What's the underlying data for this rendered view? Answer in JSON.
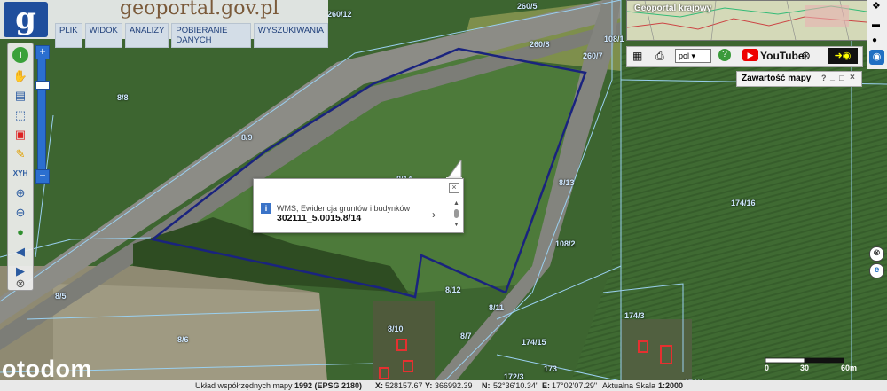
{
  "header": {
    "logo_glyph": "g",
    "site_name": "geoportal.gov.pl",
    "menu": [
      "PLIK",
      "WIDOK",
      "ANALIZY",
      "POBIERANIE DANYCH",
      "WYSZUKIWANIA"
    ]
  },
  "overview": {
    "title": "Geoportal krajowy"
  },
  "toolbar_right": {
    "language": "pol",
    "youtube_label": "YouTube"
  },
  "legend_panel": {
    "title": "Zawartość mapy",
    "buttons": [
      "?",
      "_",
      "□",
      "×"
    ]
  },
  "popup": {
    "source": "WMS, Ewidencja gruntów i budynków",
    "parcel_id": "302111_5.0015.8/14"
  },
  "parcels": [
    {
      "label": "260/12"
    },
    {
      "label": "260/5"
    },
    {
      "label": "260/8"
    },
    {
      "label": "260/7"
    },
    {
      "label": "108/1"
    },
    {
      "label": "8/8"
    },
    {
      "label": "8/9"
    },
    {
      "label": "8/14"
    },
    {
      "label": "8/13"
    },
    {
      "label": "174/16"
    },
    {
      "label": "108/2"
    },
    {
      "label": "8/12"
    },
    {
      "label": "8/11"
    },
    {
      "label": "8/5"
    },
    {
      "label": "8/10"
    },
    {
      "label": "8/7"
    },
    {
      "label": "8/6"
    },
    {
      "label": "174/15"
    },
    {
      "label": "174/3"
    },
    {
      "label": "173"
    },
    {
      "label": "172/3"
    },
    {
      "label": "174/4"
    }
  ],
  "scale": {
    "ticks": [
      "0",
      "30",
      "60m"
    ]
  },
  "status": {
    "crs_label": "Układ współrzędnych mapy",
    "crs_value": "1992 (EPSG 2180)",
    "x_label": "X:",
    "x_value": "528157.67",
    "y_label": "Y:",
    "y_value": "366992.39",
    "n_label": "N:",
    "n_value": "52°36'10.34\"",
    "e_label": "E:",
    "e_value": "17°02'07.29\"",
    "scale_label": "Aktualna Skala",
    "scale_value": "1:2000"
  },
  "watermark": "otodom",
  "colors": {
    "parcel_outline": "#1a237e",
    "accent": "#1f4e9c",
    "grid_line": "#9ad0f0"
  }
}
